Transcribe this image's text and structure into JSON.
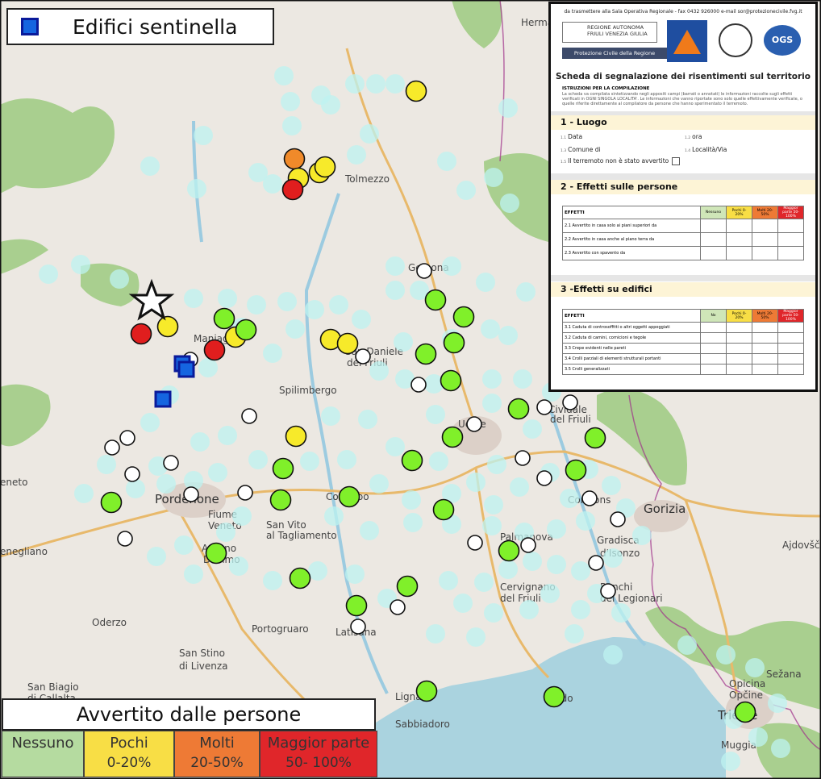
{
  "map": {
    "places": [
      {
        "name": "Tolmezzo",
        "big": false
      },
      {
        "name": "Gemona",
        "big": false
      },
      {
        "name": "San Daniele",
        "big": false
      },
      {
        "name": "del Friuli",
        "big": false
      },
      {
        "name": "Spilimbergo",
        "big": false
      },
      {
        "name": "Udine",
        "big": false
      },
      {
        "name": "Cividale",
        "big": false
      },
      {
        "name": "del Friuli",
        "big": false
      },
      {
        "name": "Pordenone",
        "big": true
      },
      {
        "name": "Fiume",
        "big": false
      },
      {
        "name": "Veneto",
        "big": false
      },
      {
        "name": "San Vito",
        "big": false
      },
      {
        "name": "al Tagliamento",
        "big": false
      },
      {
        "name": "Codroipo",
        "big": false
      },
      {
        "name": "Gorizia",
        "big": true
      },
      {
        "name": "Cormons",
        "big": false
      },
      {
        "name": "Palmanova",
        "big": false
      },
      {
        "name": "Gradisca",
        "big": false
      },
      {
        "name": "d'Isonzo",
        "big": false
      },
      {
        "name": "Cervignano",
        "big": false
      },
      {
        "name": "del Friuli",
        "big": false
      },
      {
        "name": "Ronchi",
        "big": false
      },
      {
        "name": "dei Legionari",
        "big": false
      },
      {
        "name": "Azzano",
        "big": false
      },
      {
        "name": "Decimo",
        "big": false
      },
      {
        "name": "Portogruaro",
        "big": false
      },
      {
        "name": "Latisana",
        "big": false
      },
      {
        "name": "Oderzo",
        "big": false
      },
      {
        "name": "San Stino",
        "big": false
      },
      {
        "name": "di Livenza",
        "big": false
      },
      {
        "name": "San Biagio",
        "big": false
      },
      {
        "name": "di Callalta",
        "big": false
      },
      {
        "name": "Lignano",
        "big": false
      },
      {
        "name": "Sabbiadoro",
        "big": false
      },
      {
        "name": "Grado",
        "big": false
      },
      {
        "name": "Trieste",
        "big": true
      },
      {
        "name": "Opicina",
        "big": false
      },
      {
        "name": "Opčine",
        "big": false
      },
      {
        "name": "Sežana",
        "big": false
      },
      {
        "name": "Ajdovšč",
        "big": false
      },
      {
        "name": "Muggia",
        "big": false
      },
      {
        "name": "Maniago",
        "big": false
      },
      {
        "name": "Hermag",
        "big": false
      },
      {
        "name": "enegliano",
        "big": false
      },
      {
        "name": "eneto",
        "big": false
      }
    ],
    "colors": {
      "nessuno": "#80f02a",
      "pochi": "#f7ea2a",
      "molti": "#f08a2a",
      "maggior": "#e01e1e",
      "not_felt": "#ffffff",
      "faint": "#bdf3f0",
      "sentinel": "#1565e0"
    }
  },
  "sentinel_legend": {
    "label": "Edifici sentinella"
  },
  "felt_legend": {
    "title": "Avvertito dalle persone",
    "cells": [
      {
        "label": "Nessuno",
        "range": "",
        "color": "#b5dba0"
      },
      {
        "label": "Pochi",
        "range": "0-20%",
        "color": "#f8de45"
      },
      {
        "label": "Molti",
        "range": "20-50%",
        "color": "#ee7a35"
      },
      {
        "label": "Maggior parte",
        "range": "50- 100%",
        "color": "#e0262a"
      }
    ]
  },
  "form": {
    "header": "da trasmettere alla Sala Operativa Regionale - fax 0432 926000 e-mail sor@protezionecivile.fvg.it",
    "region_logo": "REGIONE AUTONOMA\nFRIULI VENEZIA GIULIA",
    "region_sub": "Protezione Civile della Regione",
    "ogs_logo": "OGS",
    "title": "Scheda di segnalazione dei risentimenti sul territorio",
    "instr_heading": "ISTRUZIONI PER LA COMPILAZIONE",
    "instr_text": "La scheda va compilata sintetizzando negli appositi campi (barrati o annotati) le informazioni raccolte sugli effetti verificati in OGNI SINGOLA LOCALITA'. Le informazioni che vanno riportate sono solo quelle effettivamente verificate, o quelle riferite direttamente al compilatore da persone che hanno sperimentato il terremoto.",
    "sec1": "1 - Luogo",
    "f_data": "Data",
    "f_ora": "ora",
    "f_comune": "Comune di",
    "f_localita": "Località/Via",
    "f_non": "Il terremoto non è stato avvertito",
    "n_data": "1.1",
    "n_ora": "1.2",
    "n_comune": "1.3",
    "n_loc": "1.4",
    "n_non": "1.5",
    "sec2": "2 - Effetti sulle persone",
    "t2_head": [
      "EFFETTI",
      "Nessuno",
      "Pochi 0-20%",
      "Molti 20-50%",
      "Maggior parte 50-100%"
    ],
    "t2_rows": [
      "2.1 Avvertito in casa solo ai piani superiori da",
      "2.2 Avvertito in casa anche al piano terra da",
      "2.3 Avvertito con spavento da"
    ],
    "sec3": "3 -Effetti su edifici",
    "t3_head": [
      "EFFETTI",
      "No",
      "Pochi 0-20%",
      "Molti 20-50%",
      "Maggior parte 50-100%"
    ],
    "t3_rows": [
      "3.1 Caduta di controsoffitti o altri oggetti appoggiati",
      "3.2 Caduta di camini, cornicioni e tegole",
      "3.3 Crepe evidenti nelle pareti",
      "3.4 Crolli parziali di elementi strutturali portanti",
      "3.5 Crolli generalizzati"
    ]
  }
}
